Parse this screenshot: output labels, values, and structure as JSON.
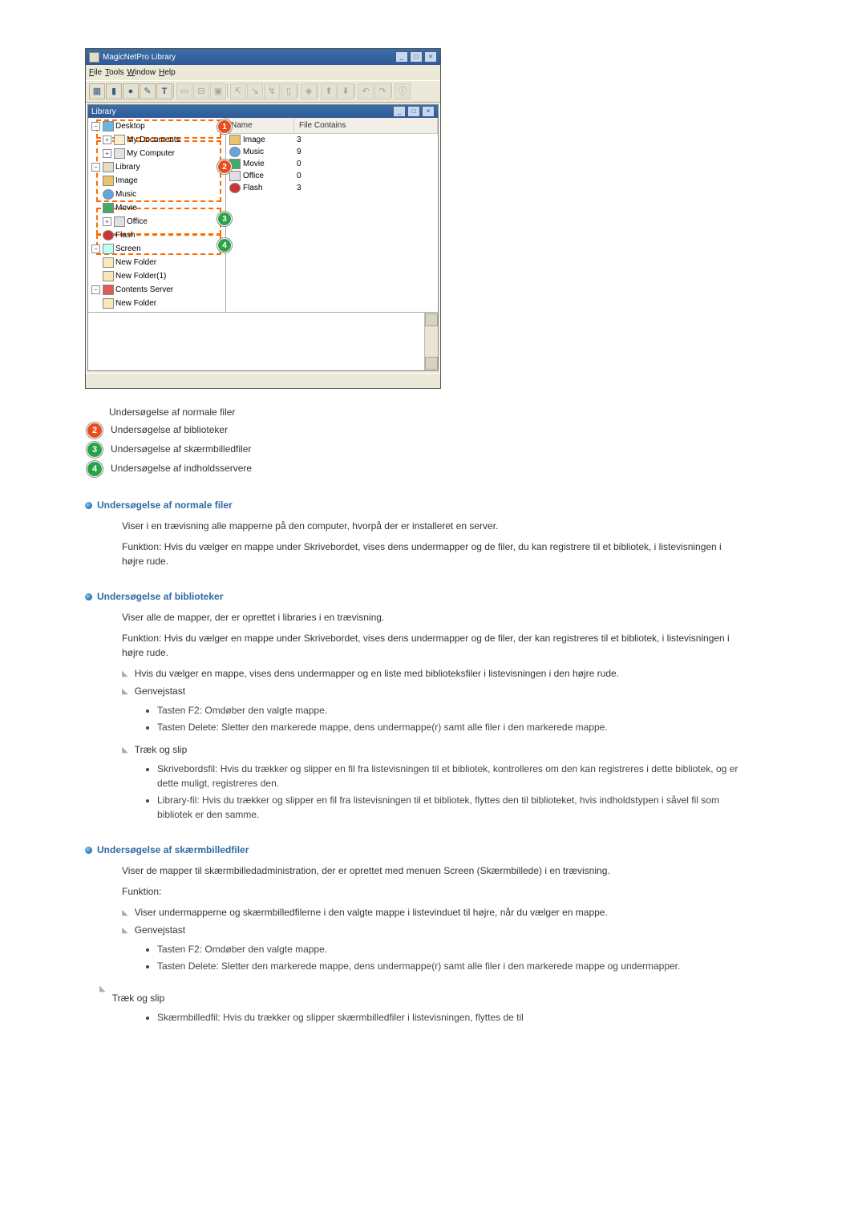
{
  "app": {
    "title": "MagicNetPro Library",
    "menus": [
      "File",
      "Tools",
      "Window",
      "Help"
    ],
    "inner_title": "Library",
    "columns": {
      "c1": "Name",
      "c2": "File Contains"
    },
    "rows": [
      {
        "icon": "img",
        "name": "Image",
        "count": "3"
      },
      {
        "icon": "mus",
        "name": "Music",
        "count": "9"
      },
      {
        "icon": "mov",
        "name": "Movie",
        "count": "0"
      },
      {
        "icon": "off",
        "name": "Office",
        "count": "0"
      },
      {
        "icon": "fla",
        "name": "Flash",
        "count": "3"
      }
    ],
    "tree": {
      "desktop": "Desktop",
      "mydocs": "My Documents",
      "mycomp": "My Computer",
      "library": "Library",
      "image": "Image",
      "music": "Music",
      "movie": "Movie",
      "office": "Office",
      "flash": "Flash",
      "screen": "Screen",
      "newfolder": "New Folder",
      "newfolder1": "New Folder(1)",
      "contents_server": "Contents Server",
      "newfolder_cs": "New Folder"
    },
    "badges": {
      "b1": "1",
      "b2": "2",
      "b3": "3",
      "b4": "4"
    }
  },
  "legend": {
    "l1": "Undersøgelse af normale filer",
    "l2": "Undersøgelse af biblioteker",
    "l3": "Undersøgelse af skærmbilledfiler",
    "l4": "Undersøgelse af indholdsservere"
  },
  "sections": {
    "s1": {
      "title": "Undersøgelse af normale filer",
      "p1": "Viser i en trævisning alle mapperne på den computer, hvorpå der er installeret en server.",
      "p2": "Funktion: Hvis du vælger en mappe under Skrivebordet, vises dens undermapper og de filer, du kan registrere til et bibliotek, i listevisningen i højre rude."
    },
    "s2": {
      "title": "Undersøgelse af biblioteker",
      "p1": "Viser alle de mapper, der er oprettet i libraries i en trævisning.",
      "p2": "Funktion: Hvis du vælger en mappe under Skrivebordet, vises dens undermapper og de filer, der kan registreres til et bibliotek, i listevisningen i højre rude.",
      "a1": "Hvis du vælger en mappe, vises dens undermapper og en liste med biblioteksfiler i listevisningen i den højre rude.",
      "a2": "Genvejstast",
      "b1": "Tasten F2: Omdøber den valgte mappe.",
      "b2": "Tasten Delete: Sletter den markerede mappe, dens undermappe(r) samt alle filer i den markerede mappe.",
      "a3": "Træk og slip",
      "b3": "Skrivebordsfil: Hvis du trækker og slipper en fil fra listevisningen til et bibliotek, kontrolleres om den kan registreres i dette bibliotek, og er dette muligt, registreres den.",
      "b4": "Library-fil: Hvis du trækker og slipper en fil fra listevisningen til et bibliotek, flyttes den til biblioteket, hvis indholdstypen i såvel fil som bibliotek er den samme."
    },
    "s3": {
      "title": "Undersøgelse af skærmbilledfiler",
      "p1": "Viser de mapper til skærmbilledadministration, der er oprettet med menuen Screen (Skærmbillede) i en trævisning.",
      "p2": "Funktion:",
      "a1": "Viser undermapperne og skærmbilledfilerne i den valgte mappe i listevinduet til højre, når du vælger en mappe.",
      "a2": "Genvejstast",
      "b1": "Tasten F2: Omdøber den valgte mappe.",
      "b2": "Tasten Delete: Sletter den markerede mappe, dens undermappe(r) samt alle filer i den markerede mappe og undermapper.",
      "a3": "Træk og slip",
      "b3": "Skærmbilledfil: Hvis du trækker og slipper skærmbilledfiler i listevisningen, flyttes de til"
    }
  }
}
